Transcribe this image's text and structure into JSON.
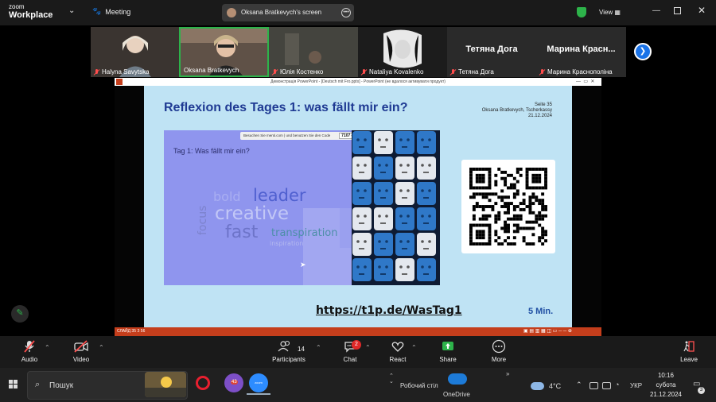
{
  "zoom": {
    "logo_top": "zoom",
    "logo_bottom": "Workplace",
    "meeting_label": "Meeting",
    "share_label": "Oksana Bratkevych's screen",
    "view_label": "View"
  },
  "participants": [
    {
      "name": "Halyna Savytska",
      "muted": true
    },
    {
      "name": "Oksana Bratkevych",
      "muted": false,
      "active_speaker": true
    },
    {
      "name": "Юлія Костенко",
      "muted": true
    },
    {
      "name": "Nataliya Kovalenko",
      "muted": true
    },
    {
      "name": "Тетяна Дога",
      "big_label": "Тетяна Дога",
      "muted": true
    },
    {
      "name": "Марина Краснополіна",
      "big_label": "Марина Красн...",
      "muted": true
    }
  ],
  "powerpoint": {
    "window_title": "Демонстрація PowerPoint - [Deutsch mit Fro.pptx] - PowerPoint (не вдалося активувати продукт)",
    "status_left": "СЛАЙД 35 З 56",
    "status_right": "▣ ▤ ▥ ▦ ◫ ▭ ─ ─ ⊕"
  },
  "slide": {
    "title": "Reflexion des Tages 1: was fällt mir ein?",
    "meta_lines": [
      "Seite 35",
      "Oksana Bratkevych, Tscherkassy",
      "21.12.2024"
    ],
    "menti_instruction": "Besuchen Sie menti.com | und benutzen Sie den Code",
    "menti_code": "7107 4432",
    "menti_question": "Tag 1: Was fällt mir ein?",
    "words": [
      {
        "text": "bold",
        "color": "#a9aef2"
      },
      {
        "text": "leader",
        "color": "#5060d0"
      },
      {
        "text": "creative",
        "color": "#c2c7f6"
      },
      {
        "text": "focus",
        "color": "#7c82cc"
      },
      {
        "text": "fast",
        "color": "#6d74c9"
      },
      {
        "text": "transpiration",
        "color": "#4d8fa8"
      },
      {
        "text": "inspiration",
        "color": "#b4b9ef"
      }
    ],
    "link": "https://t1p.de/WasTag1",
    "time": "5 Min."
  },
  "toolbar": {
    "audio": "Audio",
    "video": "Video",
    "participants": "Participants",
    "participants_count": "14",
    "chat": "Chat",
    "chat_badge": "2",
    "react": "React",
    "share": "Share",
    "more": "More",
    "leave": "Leave"
  },
  "taskbar": {
    "search_placeholder": "Пошук",
    "viber_badge": "43",
    "zoom_app": "zoom",
    "desktop_label": "Робочий стіл",
    "onedrive_label": "OneDrive",
    "temperature": "4°C",
    "language": "УКР",
    "time": "10:16",
    "day": "субота",
    "date": "21.12.2024",
    "notifications": "3"
  },
  "colors": {
    "accent_green": "#2db34a",
    "zoom_blue": "#1a73e8",
    "ppt_red": "#c43e1c",
    "slide_bg": "#bfe3f4",
    "menti_bg": "#8f95ee",
    "mute_red": "#ff4d4d"
  }
}
